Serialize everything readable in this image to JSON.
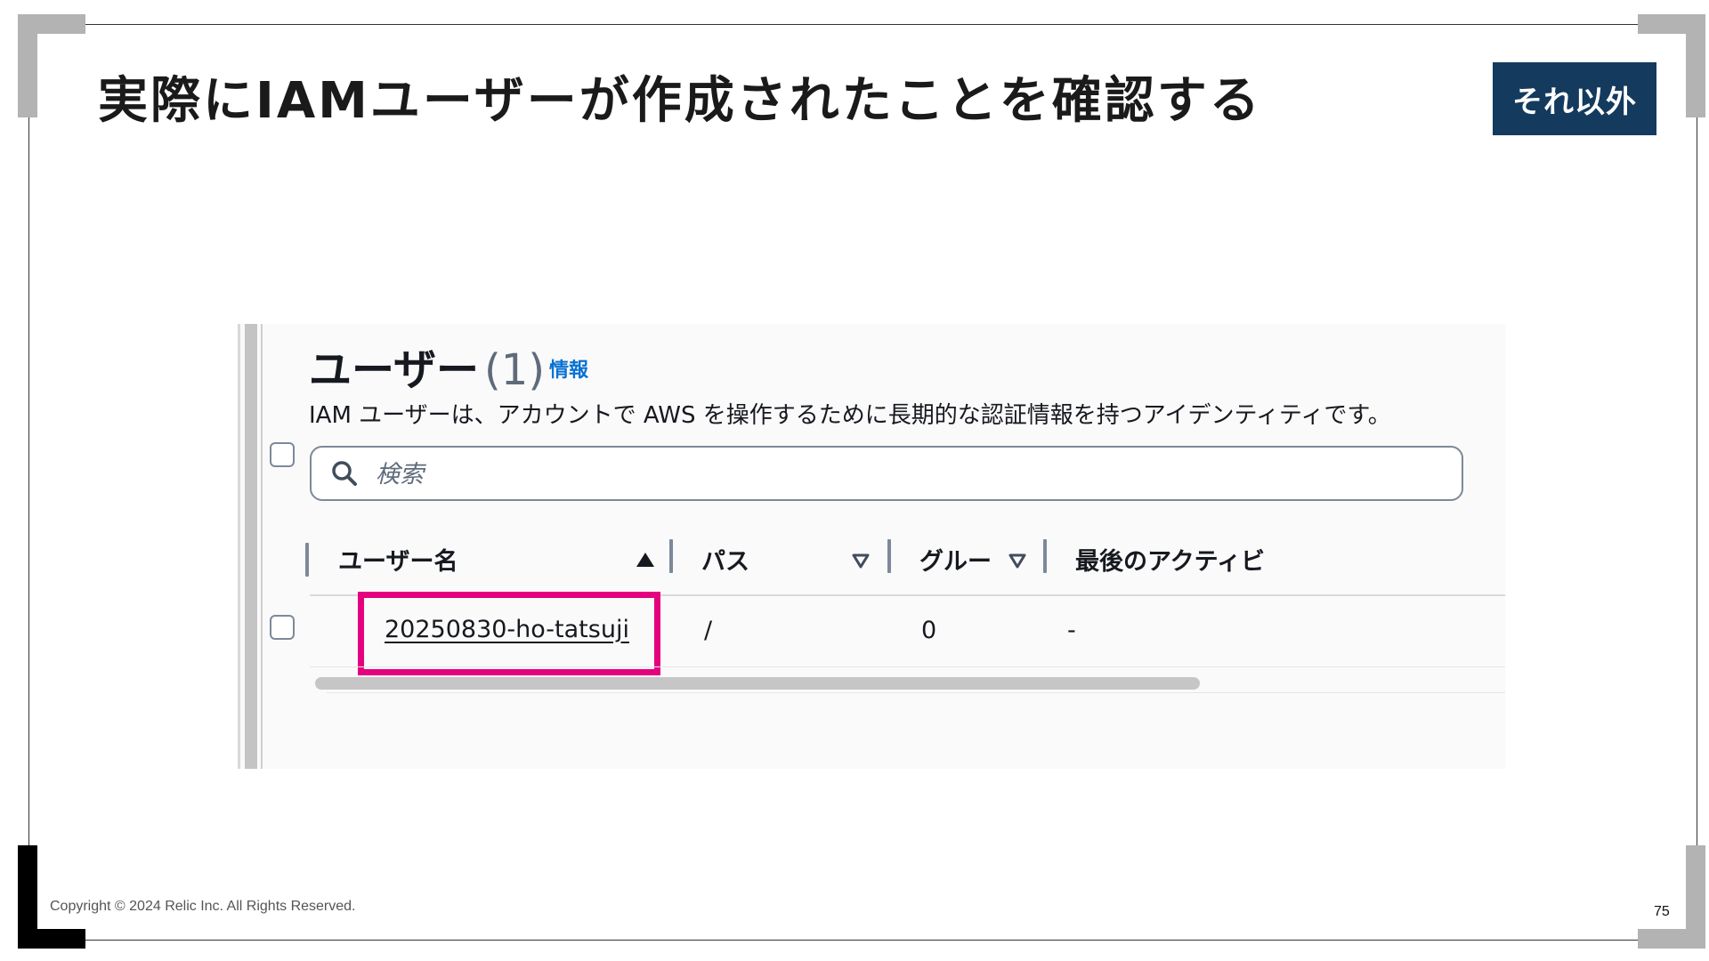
{
  "slide": {
    "title": "実際にIAMユーザーが作成されたことを確認する",
    "tag": "それ以外",
    "copyright": "Copyright © 2024 Relic Inc. All Rights Reserved.",
    "page_number": "75"
  },
  "users_panel": {
    "title": "ユーザー",
    "count": "(1)",
    "info_link": "情報",
    "description": "IAM ユーザーは、アカウントで AWS を操作するために長期的な認証情報を持つアイデンティティです。",
    "search": {
      "placeholder": "検索"
    },
    "columns": [
      "ユーザー名",
      "パス",
      "グルー",
      "最後のアクティビ"
    ],
    "rows": [
      {
        "user_name": "20250830-ho-tatsuji",
        "path": "/",
        "groups": "0",
        "last_activity": "-"
      }
    ],
    "highlight_color": "#e4007f"
  },
  "colors": {
    "badge_bg": "#143a5e",
    "link_blue": "#0972d3"
  }
}
